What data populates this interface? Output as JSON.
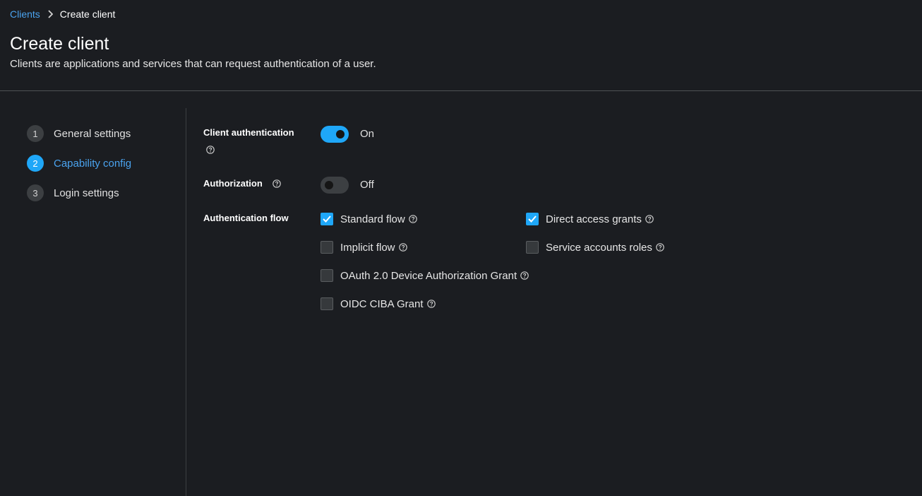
{
  "breadcrumb": {
    "parent": "Clients",
    "current": "Create client"
  },
  "page": {
    "title": "Create client",
    "subtitle": "Clients are applications and services that can request authentication of a user."
  },
  "wizard": {
    "steps": [
      {
        "num": "1",
        "label": "General settings"
      },
      {
        "num": "2",
        "label": "Capability config"
      },
      {
        "num": "3",
        "label": "Login settings"
      }
    ],
    "active_step": 2
  },
  "form": {
    "client_authentication": {
      "label": "Client authentication",
      "state": "On",
      "enabled": true
    },
    "authorization": {
      "label": "Authorization",
      "state": "Off",
      "enabled": false
    },
    "authentication_flow": {
      "label": "Authentication flow",
      "options": [
        {
          "label": "Standard flow",
          "checked": true
        },
        {
          "label": "Direct access grants",
          "checked": true
        },
        {
          "label": "Implicit flow",
          "checked": false
        },
        {
          "label": "Service accounts roles",
          "checked": false
        },
        {
          "label": "OAuth 2.0 Device Authorization Grant",
          "checked": false
        },
        {
          "label": "OIDC CIBA Grant",
          "checked": false
        }
      ]
    }
  },
  "colors": {
    "accent": "#1fa7f8",
    "link": "#4aa3ef",
    "background": "#1b1d21"
  },
  "icons": {
    "breadcrumb_separator": "chevron-right-icon",
    "help": "help-circle-icon",
    "check": "check-icon"
  }
}
